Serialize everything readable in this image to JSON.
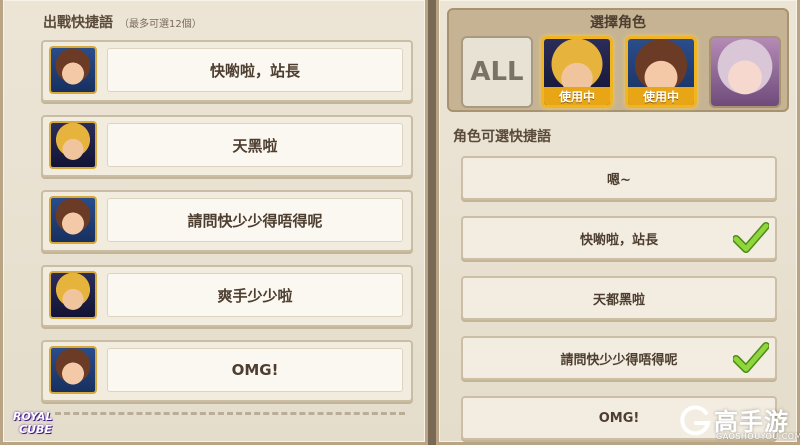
{
  "left_panel": {
    "title": "出戰快捷語",
    "subtitle": "（最多可選12個）",
    "rows": [
      {
        "label": "快喲啦，站長",
        "avatar": "girl"
      },
      {
        "label": "天黑啦",
        "avatar": "boy"
      },
      {
        "label": "請問快少少得唔得呢",
        "avatar": "girl"
      },
      {
        "label": "爽手少少啦",
        "avatar": "boy"
      },
      {
        "label": "OMG!",
        "avatar": "girl"
      }
    ]
  },
  "right_panel": {
    "select_title": "選擇角色",
    "all_label": "ALL",
    "characters": [
      {
        "name": "boy",
        "badge": "使用中"
      },
      {
        "name": "girl",
        "badge": "使用中"
      },
      {
        "name": "elf",
        "badge": ""
      }
    ],
    "phrase_title": "角色可選快捷語",
    "phrases": [
      {
        "label": "嗯~",
        "checked": false
      },
      {
        "label": "快喲啦，站長",
        "checked": true
      },
      {
        "label": "天都黑啦",
        "checked": false
      },
      {
        "label": "請問快少少得唔得呢",
        "checked": true
      },
      {
        "label": "OMG!",
        "checked": false
      }
    ]
  },
  "logo": {
    "line1": "ROYAL",
    "line2": "CUBE"
  },
  "watermark": {
    "main": "高手游",
    "sub": "GAOSHOUYOU.COM"
  },
  "colors": {
    "badge": "#e8a515",
    "check": "#7cc234",
    "frame_gold": "#d6a93a"
  }
}
